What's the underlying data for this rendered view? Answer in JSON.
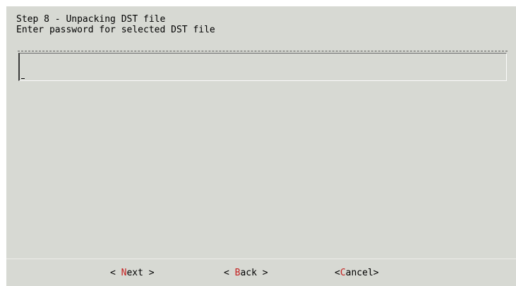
{
  "dialog": {
    "step_title": "Step 8 - Unpacking DST file",
    "prompt": "Enter password for selected DST file"
  },
  "password_input": {
    "value": ""
  },
  "buttons": {
    "next": {
      "open": "< ",
      "hotkey": "N",
      "rest": "ext",
      "close": " >"
    },
    "back": {
      "open": "< ",
      "hotkey": "B",
      "rest": "ack",
      "close": " >"
    },
    "cancel": {
      "open": "<",
      "hotkey": "C",
      "rest": "ancel",
      "close": ">"
    }
  },
  "colors": {
    "background": "#d7d9d3",
    "hotkey": "#c42020"
  }
}
